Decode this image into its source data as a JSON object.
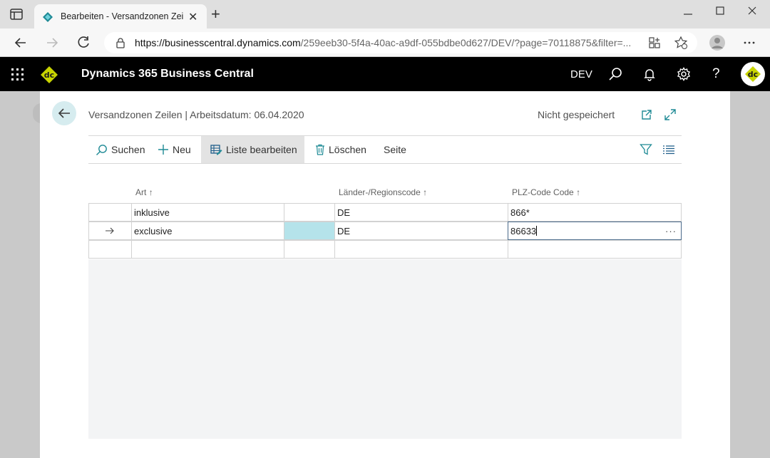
{
  "browser": {
    "tab_title": "Bearbeiten - Versandzonen Zeilen",
    "url_main": "https://businesscentral.dynamics.com",
    "url_rest": "/259eeb30-5f4a-40ac-a9df-055bdbe0d627/DEV/?page=70118875&filter=..."
  },
  "app": {
    "logo_text": "dc",
    "title": "Dynamics 365 Business Central",
    "environment": "DEV",
    "help": "?"
  },
  "dialog": {
    "title": "Versandzonen Zeilen | Arbeitsdatum: 06.04.2020",
    "status": "Nicht gespeichert"
  },
  "actions": {
    "search": "Suchen",
    "new": "Neu",
    "edit_list": "Liste bearbeiten",
    "delete": "Löschen",
    "page": "Seite"
  },
  "columns": {
    "art": "Art",
    "region": "Länder-/Regionscode",
    "plz": "PLZ-Code Code",
    "sort_arrow": "↑"
  },
  "rows": [
    {
      "art": "inklusive",
      "region": "DE",
      "plz": "866*"
    },
    {
      "art": "exclusive",
      "region": "DE",
      "plz": "86633"
    },
    {
      "art": "",
      "region": "",
      "plz": ""
    }
  ],
  "ui": {
    "more_dots": "···",
    "accent": "#1e8a95",
    "selected_cell": "#b5e3ea"
  }
}
